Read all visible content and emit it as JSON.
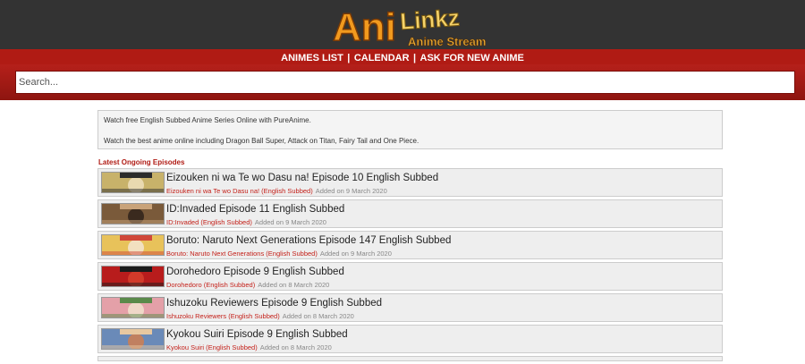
{
  "logo": {
    "main_text": "Ani",
    "secondary_text": "Linkz",
    "tagline": "Anime Stream"
  },
  "nav": {
    "items": [
      {
        "label": "ANIMES LIST"
      },
      {
        "label": "CALENDAR"
      },
      {
        "label": "ASK FOR NEW ANIME"
      }
    ],
    "separator": "|"
  },
  "search": {
    "placeholder": "Search..."
  },
  "intro": {
    "line1": "Watch free English Subbed Anime Series Online with PureAnime.",
    "line2": "Watch the best anime online including Dragon Ball Super, Attack on Titan, Fairy Tail and One Piece."
  },
  "latest": {
    "heading": "Latest Ongoing Episodes",
    "episodes": [
      {
        "title": "Eizouken ni wa Te wo Dasu na! Episode 10 English Subbed",
        "series": "Eizouken ni wa Te wo Dasu na! (English Subbed)",
        "added": "Added on 9 March 2020",
        "thumb_colors": [
          "#c8b26a",
          "#2b2b2b",
          "#e9d9b0"
        ]
      },
      {
        "title": "ID:Invaded Episode 11 English Subbed",
        "series": "ID:Invaded (English Subbed)",
        "added": "Added on 9 March 2020",
        "thumb_colors": [
          "#7a5a3a",
          "#c9a37a",
          "#3a2a1e"
        ]
      },
      {
        "title": "Boruto: Naruto Next Generations Episode 147 English Subbed",
        "series": "Boruto: Naruto Next Generations (English Subbed)",
        "added": "Added on 9 March 2020",
        "thumb_colors": [
          "#e8c25a",
          "#d0483a",
          "#f2e0c0"
        ]
      },
      {
        "title": "Dorohedoro Episode 9 English Subbed",
        "series": "Dorohedoro (English Subbed)",
        "added": "Added on 8 March 2020",
        "thumb_colors": [
          "#b81c1c",
          "#1a1a1a",
          "#d23a2a"
        ]
      },
      {
        "title": "Ishuzoku Reviewers Episode 9 English Subbed",
        "series": "Ishuzoku Reviewers (English Subbed)",
        "added": "Added on 8 March 2020",
        "thumb_colors": [
          "#e4a0a8",
          "#5a8a4a",
          "#f0d8c8"
        ]
      },
      {
        "title": "Kyokou Suiri Episode 9 English Subbed",
        "series": "Kyokou Suiri (English Subbed)",
        "added": "Added on 8 March 2020",
        "thumb_colors": [
          "#6a8ab8",
          "#e8c8a0",
          "#c08060"
        ]
      }
    ]
  }
}
